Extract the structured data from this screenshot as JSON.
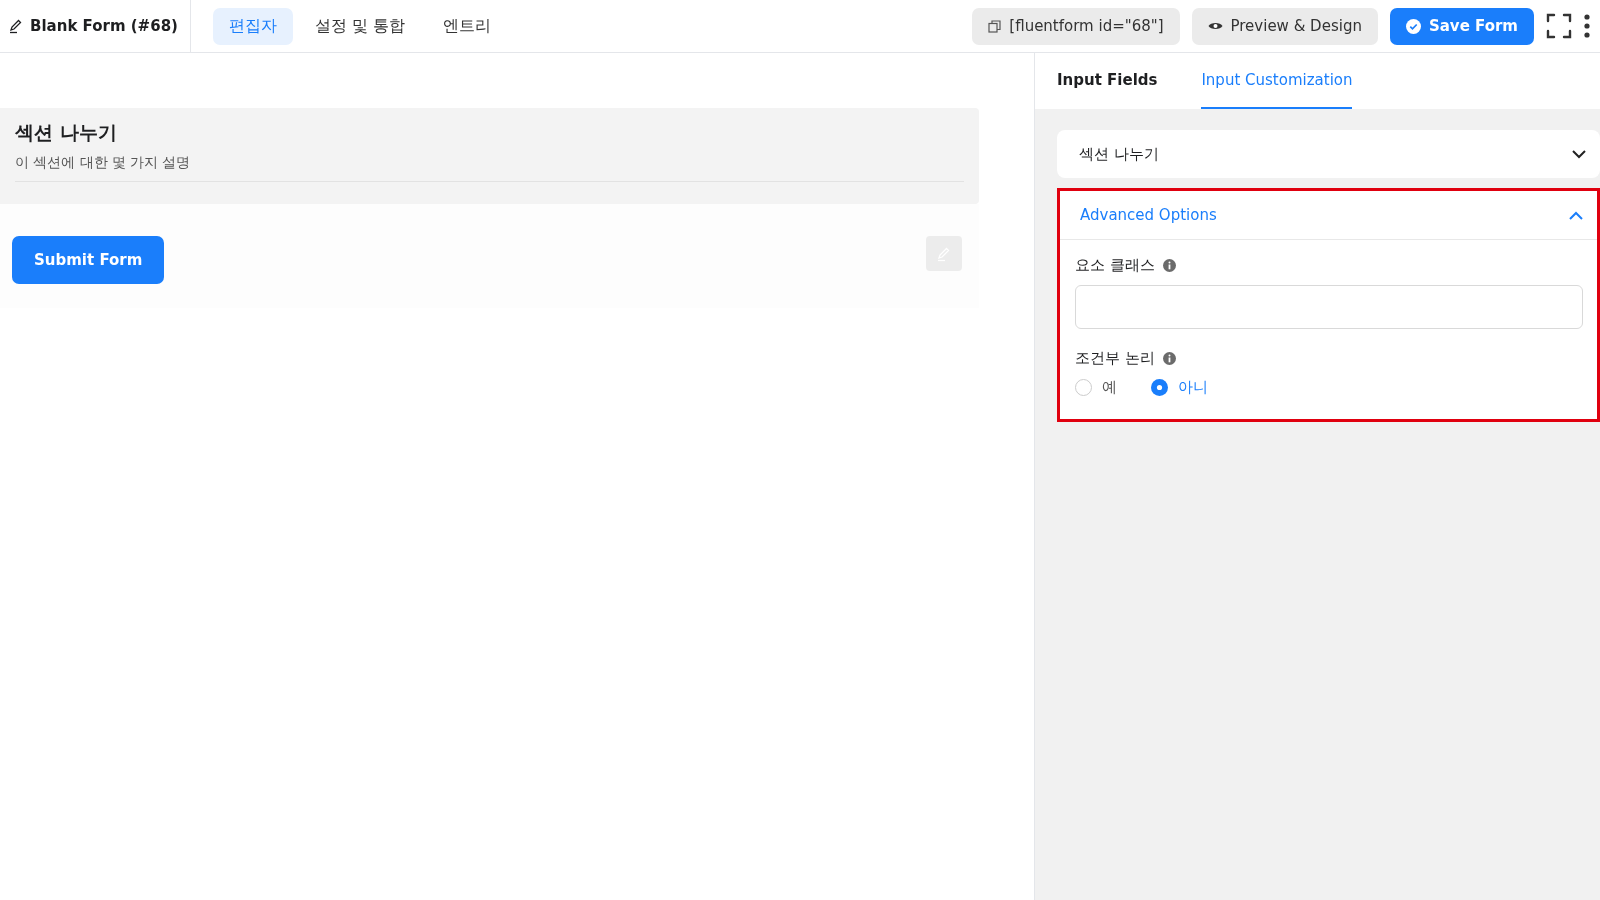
{
  "header": {
    "title": "Blank Form (#68)",
    "tabs": [
      {
        "label": "편집자",
        "selected": true
      },
      {
        "label": "설정 및 통합",
        "selected": false
      },
      {
        "label": "엔트리",
        "selected": false
      }
    ],
    "shortcode": "[fluentform id=\"68\"]",
    "preview_button": "Preview & Design",
    "save_button": "Save Form"
  },
  "canvas": {
    "section": {
      "title": "섹션 나누기",
      "description": "이 섹션에 대한 몇 가지 설명"
    },
    "submit_button": "Submit Form"
  },
  "panel": {
    "tabs": [
      {
        "label": "Input Fields",
        "selected": false
      },
      {
        "label": "Input Customization",
        "selected": true
      }
    ],
    "field_select": {
      "value": "섹션 나누기"
    },
    "advanced": {
      "title": "Advanced Options",
      "expanded": true,
      "highlighted": true,
      "fields": [
        {
          "kind": "text",
          "label": "요소 클래스"
        },
        {
          "kind": "radio",
          "label": "조건부 논리",
          "options": [
            {
              "label": "예",
              "selected": false
            },
            {
              "label": "아니",
              "selected": true
            }
          ]
        }
      ]
    }
  }
}
